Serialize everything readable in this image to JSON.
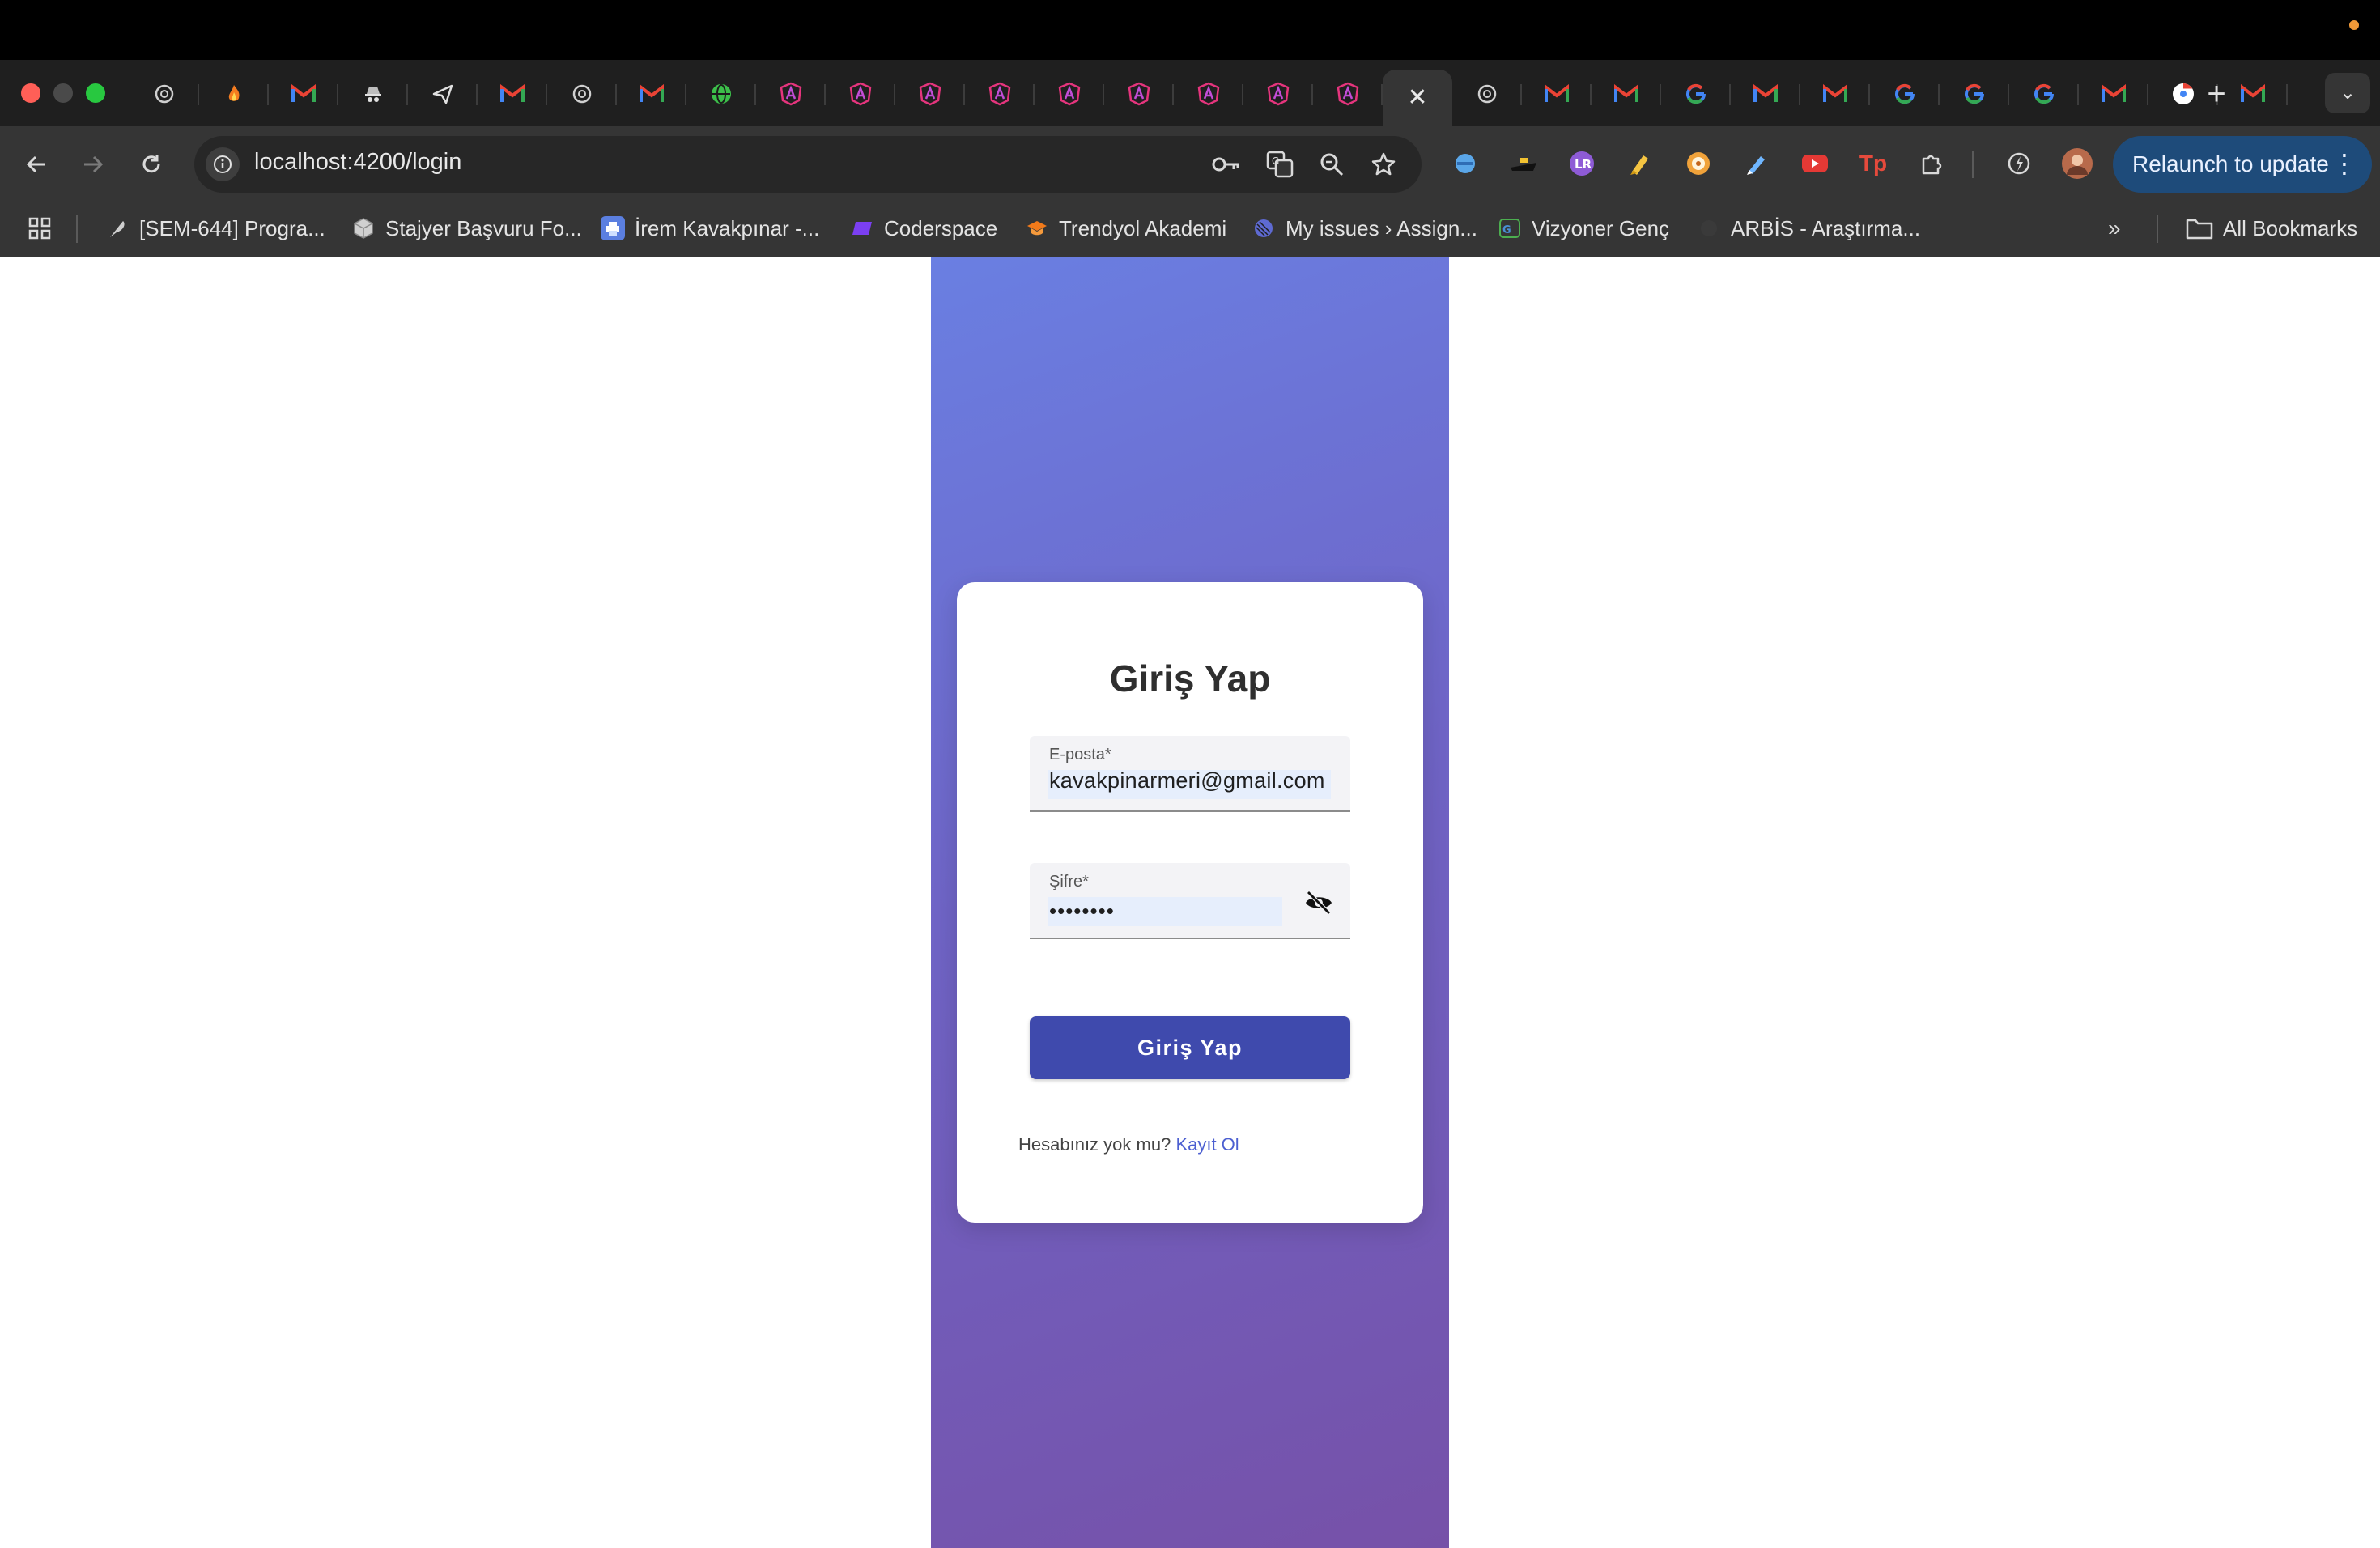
{
  "browser": {
    "tabs": [
      {
        "icon": "openai-icon"
      },
      {
        "icon": "flame-icon"
      },
      {
        "icon": "gmail-icon"
      },
      {
        "icon": "incognito-icon"
      },
      {
        "icon": "paper-plane-icon"
      },
      {
        "icon": "gmail-icon"
      },
      {
        "icon": "openai-icon"
      },
      {
        "icon": "gmail-icon"
      },
      {
        "icon": "globe-icon"
      },
      {
        "icon": "angular-icon"
      },
      {
        "icon": "angular-icon"
      },
      {
        "icon": "angular-icon"
      },
      {
        "icon": "angular-icon"
      },
      {
        "icon": "angular-icon"
      },
      {
        "icon": "angular-icon"
      },
      {
        "icon": "angular-icon"
      },
      {
        "icon": "angular-icon"
      },
      {
        "icon": "close-icon",
        "active": true
      },
      {
        "icon": "openai-icon"
      },
      {
        "icon": "gmail-icon"
      },
      {
        "icon": "gmail-icon"
      },
      {
        "icon": "google-icon"
      },
      {
        "icon": "gmail-icon"
      },
      {
        "icon": "gmail-icon"
      },
      {
        "icon": "google-icon"
      },
      {
        "icon": "google-icon"
      },
      {
        "icon": "google-icon"
      },
      {
        "icon": "gmail-icon"
      },
      {
        "icon": "chrome-icon"
      },
      {
        "icon": "gmail-icon"
      }
    ],
    "address": {
      "url": "localhost:4200/login"
    },
    "relaunch_label": "Relaunch to update",
    "bookmarks": [
      {
        "label": "[SEM-644] Progra...",
        "icon": "feather-icon"
      },
      {
        "label": "Stajyer Başvuru Fo...",
        "icon": "cube-icon"
      },
      {
        "label": "İrem Kavakpınar -...",
        "icon": "printer-icon"
      },
      {
        "label": "Coderspace",
        "icon": "coderspace-icon"
      },
      {
        "label": "Trendyol Akademi",
        "icon": "grad-cap-icon"
      },
      {
        "label": "My issues › Assign...",
        "icon": "linear-icon"
      },
      {
        "label": "Vizyoner Genç",
        "icon": "vg-icon"
      },
      {
        "label": "ARBİS - Araştırma...",
        "icon": "arbis-icon"
      }
    ],
    "all_bookmarks_label": "All Bookmarks"
  },
  "login": {
    "title": "Giriş Yap",
    "email_label": "E-posta*",
    "email_value": "kavakpinarmeri@gmail.com",
    "password_label": "Şifre*",
    "password_value": "••••••••",
    "submit_label": "Giriş Yap",
    "signup_prompt": "Hesabınız yok mu?",
    "signup_link": "Kayıt Ol"
  },
  "colors": {
    "gradient_start": "#6a7fe2",
    "gradient_end": "#7651a8",
    "primary_button": "#3f4aad",
    "link": "#4c5fd1",
    "relaunch_button": "#1e4b7a"
  }
}
